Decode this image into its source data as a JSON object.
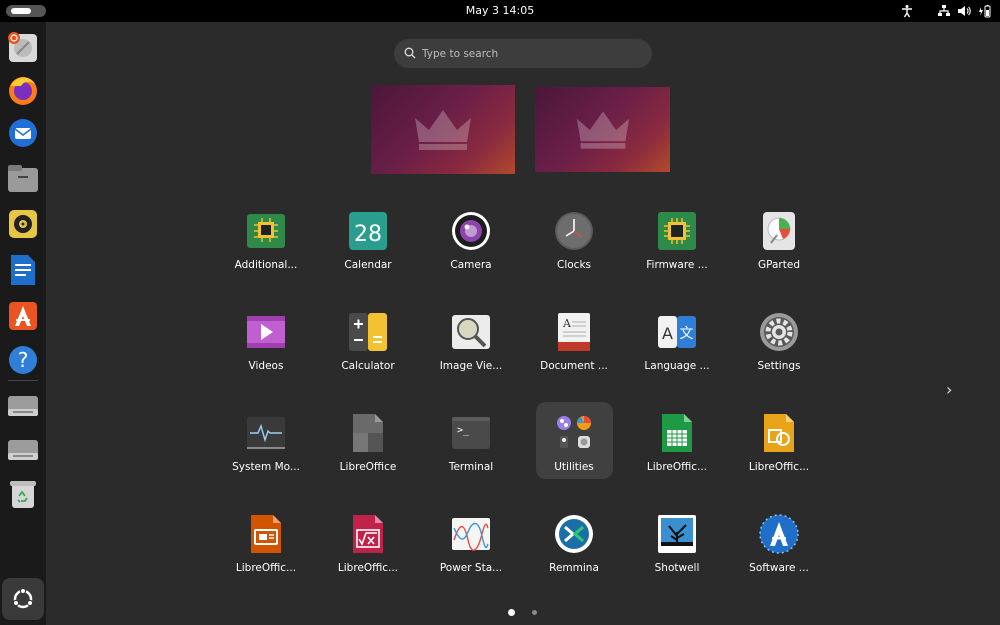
{
  "topbar": {
    "clock": "May 3  14:05",
    "tray": [
      "accessibility-icon",
      "network-icon",
      "volume-icon",
      "battery-icon"
    ]
  },
  "dock": {
    "items": [
      "ubuntu-help-icon",
      "firefox-icon",
      "thunderbird-icon",
      "files-icon",
      "rhythmbox-icon",
      "libreoffice-writer-icon",
      "app-center-icon",
      "help-icon",
      "drive-icon",
      "drive-icon",
      "trash-icon"
    ],
    "show_apps_icon": "show-apps-icon"
  },
  "search": {
    "placeholder": "Type to search"
  },
  "apps": [
    {
      "label": "Additional...",
      "icon": "additional-drivers-icon"
    },
    {
      "label": "Calendar",
      "icon": "calendar-icon",
      "day": "28"
    },
    {
      "label": "Camera",
      "icon": "camera-icon"
    },
    {
      "label": "Clocks",
      "icon": "clocks-icon"
    },
    {
      "label": "Firmware ...",
      "icon": "firmware-icon"
    },
    {
      "label": "GParted",
      "icon": "gparted-icon"
    },
    {
      "label": "Videos",
      "icon": "videos-icon"
    },
    {
      "label": "Calculator",
      "icon": "calculator-icon"
    },
    {
      "label": "Image Vie...",
      "icon": "image-viewer-icon"
    },
    {
      "label": "Document ...",
      "icon": "document-viewer-icon"
    },
    {
      "label": "Language ...",
      "icon": "language-icon",
      "glyph_a": "A",
      "glyph_b": "文"
    },
    {
      "label": "Settings",
      "icon": "settings-icon"
    },
    {
      "label": "System Mo...",
      "icon": "system-monitor-icon"
    },
    {
      "label": "LibreOffice",
      "icon": "libreoffice-icon"
    },
    {
      "label": "Terminal",
      "icon": "terminal-icon",
      "prompt": ">_"
    },
    {
      "label": "Utilities",
      "icon": "utilities-folder-icon"
    },
    {
      "label": "LibreOffic...",
      "icon": "libreoffice-calc-icon"
    },
    {
      "label": "LibreOffic...",
      "icon": "libreoffice-draw-icon"
    },
    {
      "label": "LibreOffic...",
      "icon": "libreoffice-impress-icon"
    },
    {
      "label": "LibreOffic...",
      "icon": "libreoffice-math-icon"
    },
    {
      "label": "Power Sta...",
      "icon": "power-statistics-icon"
    },
    {
      "label": "Remmina",
      "icon": "remmina-icon"
    },
    {
      "label": "Shotwell",
      "icon": "shotwell-icon"
    },
    {
      "label": "Software ...",
      "icon": "software-updater-icon"
    }
  ],
  "pager": {
    "pages": 2,
    "current": 1,
    "next_icon": "chevron-right-icon",
    "next_glyph": "›"
  },
  "colors": {
    "background": "#2b2b2b",
    "topbar": "#000000",
    "dock": "#1a1a1a",
    "accent": "#e95420"
  }
}
